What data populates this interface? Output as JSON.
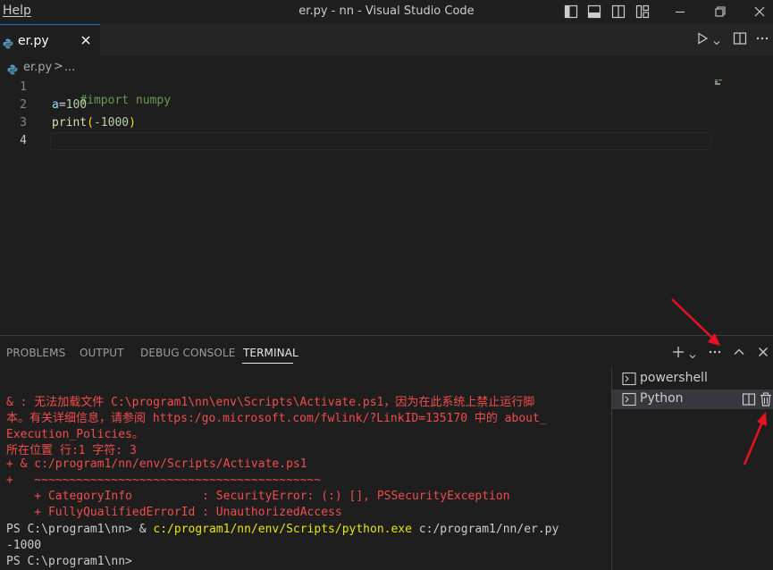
{
  "titlebar": {
    "menu_help": "Help",
    "title": "er.py - nn - Visual Studio Code",
    "icons": [
      "toggle-primary-sidebar-icon",
      "toggle-panel-icon",
      "toggle-secondary-sidebar-icon",
      "customize-layout-icon",
      "minimize-icon",
      "restore-icon",
      "close-icon"
    ]
  },
  "tabs": [
    {
      "label": "er.py",
      "icon": "python-file-icon",
      "active": true
    }
  ],
  "breadcrumb": {
    "file": "er.py",
    "separator": ">",
    "more": "..."
  },
  "editor": {
    "lines": [
      {
        "number": "1",
        "text": "#import numpy"
      },
      {
        "number": "2",
        "text": "a=100"
      },
      {
        "number": "3",
        "text": "print(-1000)"
      },
      {
        "number": "4",
        "text": ""
      }
    ],
    "tokens": {
      "comment": "#import numpy",
      "var": "a",
      "eq": "=",
      "num": "100",
      "fn": "print",
      "lparen": "(",
      "neg": "-1000",
      "rparen": ")"
    }
  },
  "panel": {
    "tabs": [
      "PROBLEMS",
      "OUTPUT",
      "DEBUG CONSOLE",
      "TERMINAL"
    ],
    "active_tab": "TERMINAL"
  },
  "terminal": {
    "lines": [
      "& : 无法加载文件 C:\\program1\\nn\\env\\Scripts\\Activate.ps1，因为在此系统上禁止运行脚",
      "本。有关详细信息，请参阅 https:/go.microsoft.com/fwlink/?LinkID=135170 中的 about_",
      "Execution_Policies。",
      "所在位置 行:1 字符: 3",
      "+ & c:/program1/nn/env/Scripts/Activate.ps1",
      "+   ~~~~~~~~~~~~~~~~~~~~~~~~~~~~~~~~~~~~~~~~~",
      "    + CategoryInfo          : SecurityError: (:) [], PSSecurityException",
      "    + FullyQualifiedErrorId : UnauthorizedAccess"
    ],
    "prompt_run": {
      "prompt": "PS C:\\program1\\nn> & ",
      "exe": "c:/program1/nn/env/Scripts/python.exe",
      "arg": " c:/program1/nn/er.py"
    },
    "output": "-1000",
    "prompt_last": "PS C:\\program1\\nn>"
  },
  "terminal_list": [
    {
      "label": "powershell",
      "icon": "terminal-icon"
    },
    {
      "label": "Python",
      "icon": "terminal-icon",
      "selected": true
    }
  ],
  "colors": {
    "error": "#f14c4c",
    "accent": "#0078d4",
    "annotation": "#e81123"
  }
}
